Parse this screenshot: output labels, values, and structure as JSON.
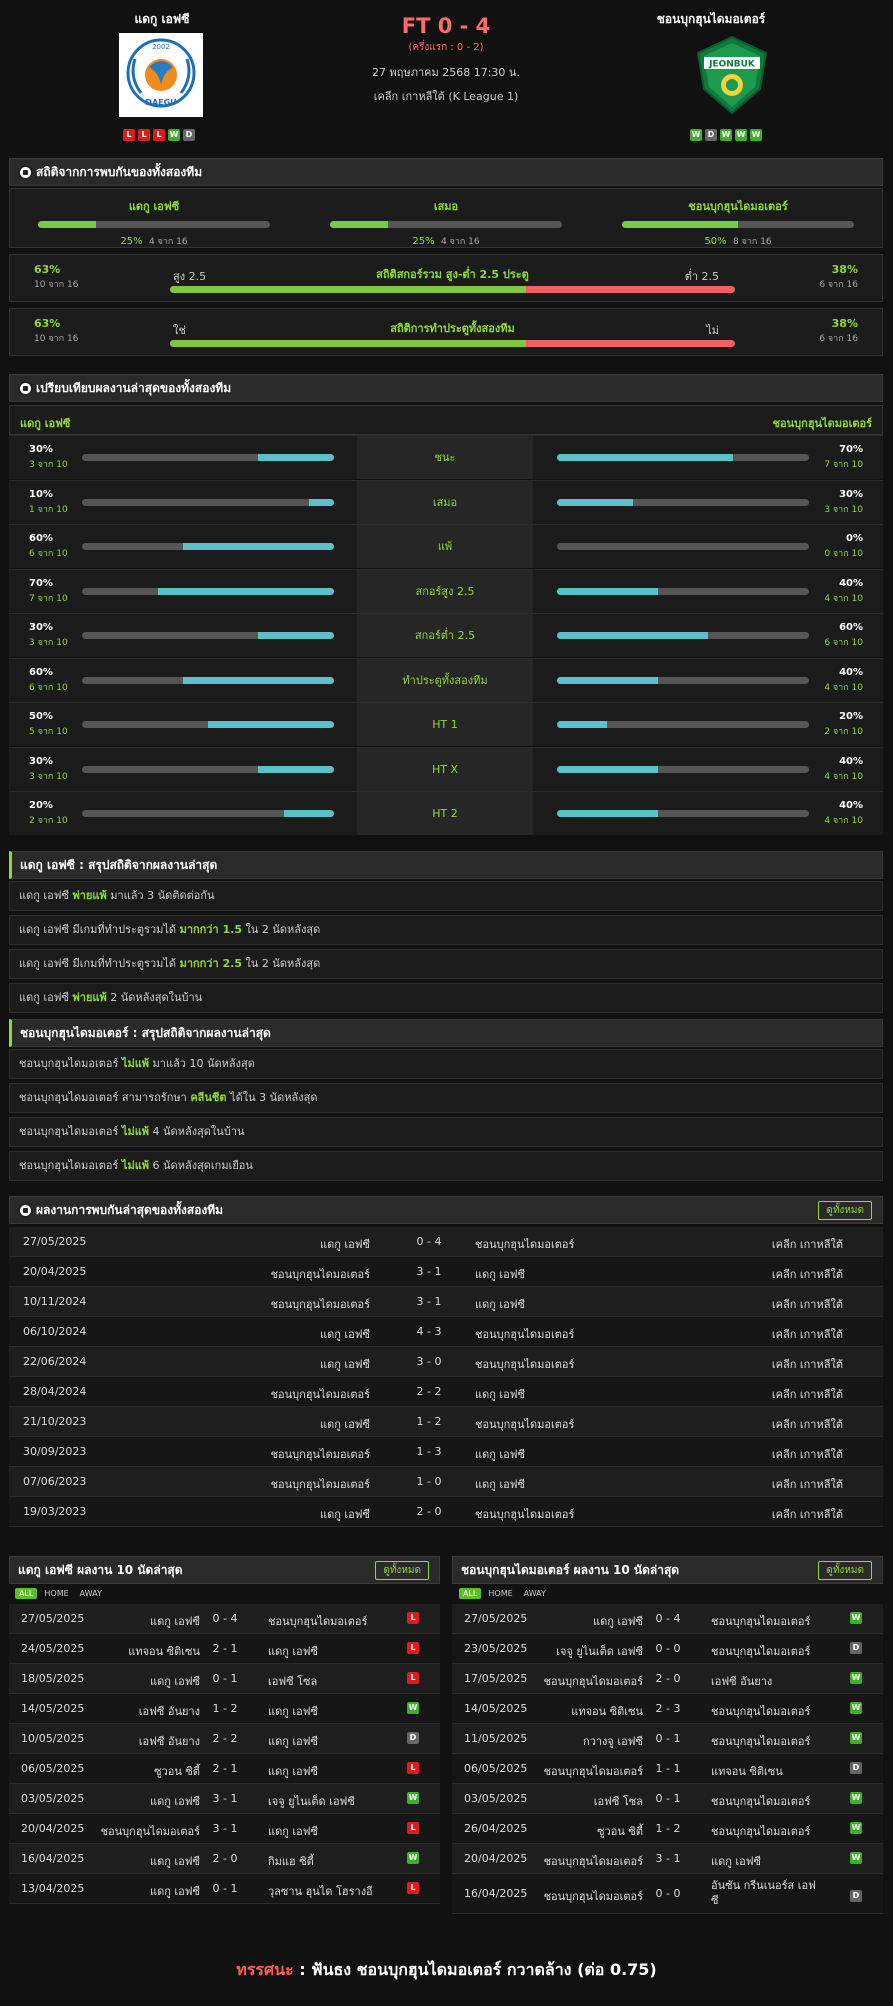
{
  "match": {
    "home": "แดกู เอฟซี",
    "away": "ชอนบุกฮุนไดมอเตอร์",
    "score": "FT 0 - 4",
    "halftime": "(ครึ่งแรก : 0 - 2)",
    "datetime": "27 พฤษภาคม 2568 17:30 น.",
    "league": "เคลีก เกาหลีใต้ (K League 1)",
    "home_form": [
      "L",
      "L",
      "L",
      "W",
      "D"
    ],
    "away_form": [
      "W",
      "D",
      "W",
      "W",
      "W"
    ],
    "home_logo_year": "2002",
    "home_logo_text": "DAEGU",
    "away_logo_text": "JEONBUK"
  },
  "h2h_stats": {
    "title": "สถิติจากการพบกันของทั้งสองทีม",
    "cols": [
      {
        "name": "แดกู เอฟซี",
        "pct": "25%",
        "count": "4 จาก 16",
        "value": 25
      },
      {
        "name": "เสมอ",
        "pct": "25%",
        "count": "4 จาก 16",
        "value": 25
      },
      {
        "name": "ชอนบุกฮุนไดมอเตอร์",
        "pct": "50%",
        "count": "8 จาก 16",
        "value": 50
      }
    ],
    "ou": {
      "title": "สถิติสกอร์รวม สูง-ต่ำ 2.5 ประตู",
      "left_label": "สูง 2.5",
      "right_label": "ต่ำ 2.5",
      "left_pct": "63%",
      "left_count": "10 จาก 16",
      "right_pct": "38%",
      "right_count": "6 จาก 16",
      "value": 63
    },
    "btts": {
      "title": "สถิติการทำประตูทั้งสองทีม",
      "left_label": "ใช่",
      "right_label": "ไม่",
      "left_pct": "63%",
      "left_count": "10 จาก 16",
      "right_pct": "38%",
      "right_count": "6 จาก 16",
      "value": 63
    }
  },
  "compare": {
    "title": "เปรียบเทียบผลงานล่าสุดของทั้งสองทีม",
    "home": "แดกู เอฟซี",
    "away": "ชอนบุกฮุนไดมอเตอร์",
    "rows": [
      {
        "label": "ชนะ",
        "lp": "30%",
        "lc": "3 จาก 10",
        "lv": 30,
        "rp": "70%",
        "rc": "7 จาก 10",
        "rv": 70
      },
      {
        "label": "เสมอ",
        "lp": "10%",
        "lc": "1 จาก 10",
        "lv": 10,
        "rp": "30%",
        "rc": "3 จาก 10",
        "rv": 30
      },
      {
        "label": "แพ้",
        "lp": "60%",
        "lc": "6 จาก 10",
        "lv": 60,
        "rp": "0%",
        "rc": "0 จาก 10",
        "rv": 0
      },
      {
        "label": "สกอร์สูง 2.5",
        "lp": "70%",
        "lc": "7 จาก 10",
        "lv": 70,
        "rp": "40%",
        "rc": "4 จาก 10",
        "rv": 40
      },
      {
        "label": "สกอร์ต่ำ 2.5",
        "lp": "30%",
        "lc": "3 จาก 10",
        "lv": 30,
        "rp": "60%",
        "rc": "6 จาก 10",
        "rv": 60
      },
      {
        "label": "ทำประตูทั้งสองทีม",
        "lp": "60%",
        "lc": "6 จาก 10",
        "lv": 60,
        "rp": "40%",
        "rc": "4 จาก 10",
        "rv": 40
      },
      {
        "label": "HT 1",
        "lp": "50%",
        "lc": "5 จาก 10",
        "lv": 50,
        "rp": "20%",
        "rc": "2 จาก 10",
        "rv": 20
      },
      {
        "label": "HT X",
        "lp": "30%",
        "lc": "3 จาก 10",
        "lv": 30,
        "rp": "40%",
        "rc": "4 จาก 10",
        "rv": 40
      },
      {
        "label": "HT 2",
        "lp": "20%",
        "lc": "2 จาก 10",
        "lv": 20,
        "rp": "40%",
        "rc": "4 จาก 10",
        "rv": 40
      }
    ]
  },
  "home_trends": {
    "title": "แดกู เอฟซี : สรุปสถิติจากผลงานล่าสุด",
    "rows": [
      {
        "a": "แดกู เอฟซี",
        "b": "พ่ายแพ้",
        "c": "มาแล้ว 3 นัดติดต่อกัน"
      },
      {
        "a": "แดกู เอฟซี มีเกมที่ทำประตูรวมได้",
        "b": "มากกว่า 1.5",
        "c": "ใน 2 นัดหลังสุด"
      },
      {
        "a": "แดกู เอฟซี มีเกมที่ทำประตูรวมได้",
        "b": "มากกว่า 2.5",
        "c": "ใน 2 นัดหลังสุด"
      },
      {
        "a": "แดกู เอฟซี",
        "b": "พ่ายแพ้",
        "c": "2 นัดหลังสุดในบ้าน"
      }
    ]
  },
  "away_trends": {
    "title": "ชอนบุกฮุนไดมอเตอร์ : สรุปสถิติจากผลงานล่าสุด",
    "rows": [
      {
        "a": "ชอนบุกฮุนไดมอเตอร์",
        "b": "ไม่แพ้",
        "c": "มาแล้ว 10 นัดหลังสุด"
      },
      {
        "a": "ชอนบุกฮุนไดมอเตอร์ สามารถรักษา",
        "b": "คลีนชีต",
        "c": "ได้ใน 3 นัดหลังสุด"
      },
      {
        "a": "ชอนบุกฮุนไดมอเตอร์",
        "b": "ไม่แพ้",
        "c": "4 นัดหลังสุดในบ้าน"
      },
      {
        "a": "ชอนบุกฮุนไดมอเตอร์",
        "b": "ไม่แพ้",
        "c": "6 นัดหลังสุดเกมเยือน"
      }
    ]
  },
  "h2h_results": {
    "title": "ผลงานการพบกันล่าสุดของทั้งสองทีม",
    "button": "ดูทั้งหมด",
    "rows": [
      {
        "date": "27/05/2025",
        "home": "แดกู เอฟซี",
        "score": "0 - 4",
        "away": "ชอนบุกฮุนไดมอเตอร์",
        "league": "เคลีก เกาหลีใต้"
      },
      {
        "date": "20/04/2025",
        "home": "ชอนบุกฮุนไดมอเตอร์",
        "score": "3 - 1",
        "away": "แดกู เอฟซี",
        "league": "เคลีก เกาหลีใต้"
      },
      {
        "date": "10/11/2024",
        "home": "ชอนบุกฮุนไดมอเตอร์",
        "score": "3 - 1",
        "away": "แดกู เอฟซี",
        "league": "เคลีก เกาหลีใต้"
      },
      {
        "date": "06/10/2024",
        "home": "แดกู เอฟซี",
        "score": "4 - 3",
        "away": "ชอนบุกฮุนไดมอเตอร์",
        "league": "เคลีก เกาหลีใต้"
      },
      {
        "date": "22/06/2024",
        "home": "แดกู เอฟซี",
        "score": "3 - 0",
        "away": "ชอนบุกฮุนไดมอเตอร์",
        "league": "เคลีก เกาหลีใต้"
      },
      {
        "date": "28/04/2024",
        "home": "ชอนบุกฮุนไดมอเตอร์",
        "score": "2 - 2",
        "away": "แดกู เอฟซี",
        "league": "เคลีก เกาหลีใต้"
      },
      {
        "date": "21/10/2023",
        "home": "แดกู เอฟซี",
        "score": "1 - 2",
        "away": "ชอนบุกฮุนไดมอเตอร์",
        "league": "เคลีก เกาหลีใต้"
      },
      {
        "date": "30/09/2023",
        "home": "ชอนบุกฮุนไดมอเตอร์",
        "score": "1 - 3",
        "away": "แดกู เอฟซี",
        "league": "เคลีก เกาหลีใต้"
      },
      {
        "date": "07/06/2023",
        "home": "ชอนบุกฮุนไดมอเตอร์",
        "score": "1 - 0",
        "away": "แดกู เอฟซี",
        "league": "เคลีก เกาหลีใต้"
      },
      {
        "date": "19/03/2023",
        "home": "แดกู เอฟซี",
        "score": "2 - 0",
        "away": "ชอนบุกฮุนไดมอเตอร์",
        "league": "เคลีก เกาหลีใต้"
      }
    ]
  },
  "home_last10": {
    "title": "แดกู เอฟซี ผลงาน 10 นัดล่าสุด",
    "button": "ดูทั้งหมด",
    "tabs": [
      "ALL",
      "HOME",
      "AWAY"
    ],
    "rows": [
      {
        "date": "27/05/2025",
        "home": "แดกู เอฟซี",
        "score": "0 - 4",
        "away": "ชอนบุกฮุนไดมอเตอร์",
        "res": "L"
      },
      {
        "date": "24/05/2025",
        "home": "แทจอน ซิติเซน",
        "score": "2 - 1",
        "away": "แดกู เอฟซี",
        "res": "L"
      },
      {
        "date": "18/05/2025",
        "home": "แดกู เอฟซี",
        "score": "0 - 1",
        "away": "เอฟซี โซล",
        "res": "L"
      },
      {
        "date": "14/05/2025",
        "home": "เอฟซี อันยาง",
        "score": "1 - 2",
        "away": "แดกู เอฟซี",
        "res": "W"
      },
      {
        "date": "10/05/2025",
        "home": "เอฟซี อันยาง",
        "score": "2 - 2",
        "away": "แดกู เอฟซี",
        "res": "D"
      },
      {
        "date": "06/05/2025",
        "home": "ซูวอน ซิตี้",
        "score": "2 - 1",
        "away": "แดกู เอฟซี",
        "res": "L"
      },
      {
        "date": "03/05/2025",
        "home": "แดกู เอฟซี",
        "score": "3 - 1",
        "away": "เจจู ยูไนเต็ด เอฟซี",
        "res": "W"
      },
      {
        "date": "20/04/2025",
        "home": "ชอนบุกฮุนไดมอเตอร์",
        "score": "3 - 1",
        "away": "แดกู เอฟซี",
        "res": "L"
      },
      {
        "date": "16/04/2025",
        "home": "แดกู เอฟซี",
        "score": "2 - 0",
        "away": "กิมแฮ ซิตี้",
        "res": "W"
      },
      {
        "date": "13/04/2025",
        "home": "แดกู เอฟซี",
        "score": "0 - 1",
        "away": "วุลซาน ฮุนได โฮรางอี",
        "res": "L"
      }
    ]
  },
  "away_last10": {
    "title": "ชอนบุกฮุนไดมอเตอร์ ผลงาน 10 นัดล่าสุด",
    "button": "ดูทั้งหมด",
    "tabs": [
      "ALL",
      "HOME",
      "AWAY"
    ],
    "rows": [
      {
        "date": "27/05/2025",
        "home": "แดกู เอฟซี",
        "score": "0 - 4",
        "away": "ชอนบุกฮุนไดมอเตอร์",
        "res": "W"
      },
      {
        "date": "23/05/2025",
        "home": "เจจู ยูไนเต็ด เอฟซี",
        "score": "0 - 0",
        "away": "ชอนบุกฮุนไดมอเตอร์",
        "res": "D"
      },
      {
        "date": "17/05/2025",
        "home": "ชอนบุกฮุนไดมอเตอร์",
        "score": "2 - 0",
        "away": "เอฟซี อันยาง",
        "res": "W"
      },
      {
        "date": "14/05/2025",
        "home": "แทจอน ซิติเซน",
        "score": "2 - 3",
        "away": "ชอนบุกฮุนไดมอเตอร์",
        "res": "W"
      },
      {
        "date": "11/05/2025",
        "home": "กวางจู เอฟซี",
        "score": "0 - 1",
        "away": "ชอนบุกฮุนไดมอเตอร์",
        "res": "W"
      },
      {
        "date": "06/05/2025",
        "home": "ชอนบุกฮุนไดมอเตอร์",
        "score": "1 - 1",
        "away": "แทจอน ซิติเซน",
        "res": "D"
      },
      {
        "date": "03/05/2025",
        "home": "เอฟซี โซล",
        "score": "0 - 1",
        "away": "ชอนบุกฮุนไดมอเตอร์",
        "res": "W"
      },
      {
        "date": "26/04/2025",
        "home": "ซูวอน ซิตี้",
        "score": "1 - 2",
        "away": "ชอนบุกฮุนไดมอเตอร์",
        "res": "W"
      },
      {
        "date": "20/04/2025",
        "home": "ชอนบุกฮุนไดมอเตอร์",
        "score": "3 - 1",
        "away": "แดกู เอฟซี",
        "res": "W"
      },
      {
        "date": "16/04/2025",
        "home": "ชอนบุกฮุนไดมอเตอร์",
        "score": "0 - 0",
        "away": "อันซัน กรีนเนอร์ส เอฟซี",
        "res": "D"
      }
    ]
  },
  "verdict": {
    "label": "ทรรศนะ",
    "sep": ":",
    "text": "ฟันธง ชอนบุกฮุนไดมอเตอร์ กวาดล้าง (ต่อ 0.75)"
  },
  "colors": {
    "accent": "#8fd93a",
    "bar_teal": "#5bc0c8",
    "bar_green": "#7fc843",
    "bar_red": "#f06060",
    "loss": "#d91e1e",
    "win": "#3fae29",
    "draw": "#666666"
  }
}
